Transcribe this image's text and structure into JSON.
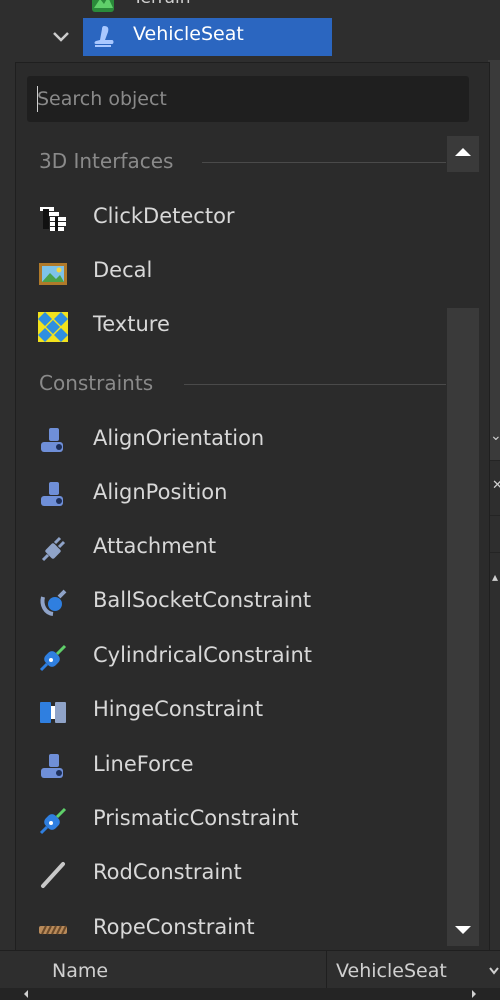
{
  "explorer": {
    "tree": [
      {
        "label": "Terrain",
        "icon": "terrain-icon"
      },
      {
        "label": "VehicleSeat",
        "icon": "vehicle-seat-icon",
        "selected": true
      }
    ]
  },
  "object_picker": {
    "search": {
      "placeholder": "Search object",
      "value": ""
    },
    "sections": [
      {
        "title": "3D Interfaces",
        "items": [
          {
            "label": "ClickDetector",
            "icon": "click-detector-icon"
          },
          {
            "label": "Decal",
            "icon": "decal-icon"
          },
          {
            "label": "Texture",
            "icon": "texture-icon"
          }
        ]
      },
      {
        "title": "Constraints",
        "items": [
          {
            "label": "AlignOrientation",
            "icon": "align-orientation-icon"
          },
          {
            "label": "AlignPosition",
            "icon": "align-position-icon"
          },
          {
            "label": "Attachment",
            "icon": "attachment-icon"
          },
          {
            "label": "BallSocketConstraint",
            "icon": "ball-socket-constraint-icon"
          },
          {
            "label": "CylindricalConstraint",
            "icon": "cylindrical-constraint-icon"
          },
          {
            "label": "HingeConstraint",
            "icon": "hinge-constraint-icon"
          },
          {
            "label": "LineForce",
            "icon": "line-force-icon"
          },
          {
            "label": "PrismaticConstraint",
            "icon": "prismatic-constraint-icon"
          },
          {
            "label": "RodConstraint",
            "icon": "rod-constraint-icon"
          },
          {
            "label": "RopeConstraint",
            "icon": "rope-constraint-icon"
          }
        ]
      }
    ]
  },
  "properties": {
    "name_label": "Name",
    "name_value": "VehicleSeat"
  },
  "colors": {
    "selection": "#2b66c0",
    "panel": "#2b2b2b",
    "background": "#2e2e2e",
    "constraint_icon": "#6f8fd8"
  }
}
